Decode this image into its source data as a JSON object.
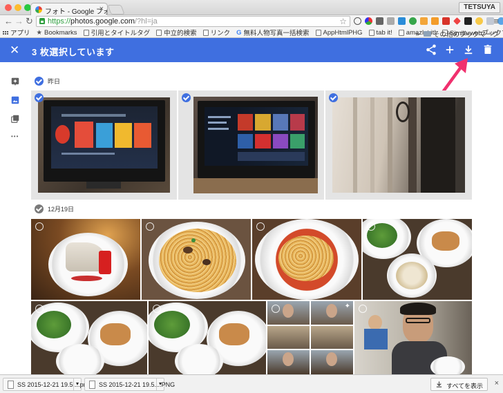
{
  "browser": {
    "tab_title": "フォト - Google フォト",
    "tab_close": "×",
    "user": "TETSUYA",
    "url_scheme": "https://",
    "url_host": "photos.google.com",
    "url_rest": "/?hl=ja",
    "bookmarks": [
      "アプリ",
      "Bookmarks",
      "引用とタイトルタグ",
      "中立的検索",
      "リンク",
      "無料人物写真一括検索",
      "AppHtmlPHG",
      "tab it!",
      "amazlet it!",
      "Similarwebブックマ…"
    ],
    "more_bookmarks": "»",
    "other_bookmarks": "その他のブックマーク"
  },
  "selection_bar": {
    "close": "✕",
    "count_label": "3 枚選択しています",
    "color": "#3f6fe0",
    "actions": [
      "share-icon",
      "add-icon",
      "download-icon",
      "delete-icon"
    ]
  },
  "sections": [
    {
      "date": "昨日",
      "selected": true
    },
    {
      "date": "12月19日",
      "selected": false
    }
  ],
  "downloads": [
    {
      "name": "SS 2015-12-21 19.5....png"
    },
    {
      "name": "SS 2015-12-21 19.5....PNG"
    }
  ],
  "downloads_show_all": "すべてを表示",
  "downloads_close": "×",
  "rail_more": "•••",
  "annotation_color": "#f0306e"
}
